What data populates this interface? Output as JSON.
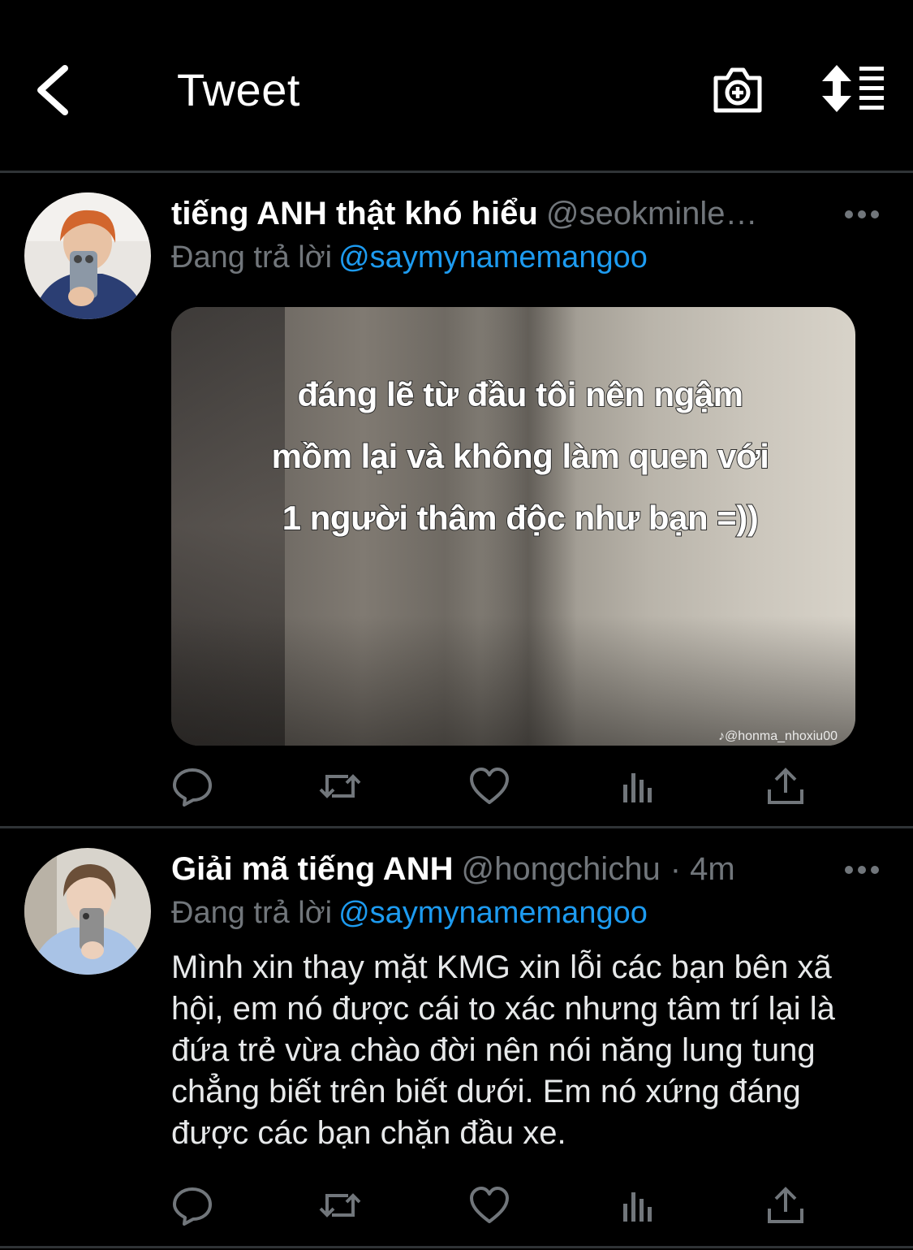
{
  "header": {
    "title": "Tweet",
    "back_icon": "back-arrow-icon",
    "camera_icon": "camera-plus-icon",
    "sort_icon": "sort-replies-icon"
  },
  "tweets": [
    {
      "display_name": "tiếng ANH thật khó hiểu",
      "handle": "@seokminle…",
      "timestamp": "",
      "reply_prefix": "Đang trả lời",
      "reply_to": "@saymynamemangoo",
      "media_caption": "đáng lẽ từ đầu tôi nên ngậm mồm lại và không làm quen với 1 người thâm độc như bạn =))",
      "media_watermark": "♪@honma_nhoxiu00"
    },
    {
      "display_name": "Giải mã tiếng ANH",
      "handle": "@hongchichu",
      "timestamp": "· 4m",
      "reply_prefix": "Đang trả lời",
      "reply_to": "@saymynamemangoo",
      "text": "Mình xin thay mặt KMG xin lỗi các bạn bên xã hội, em nó được cái to xác nhưng tâm trí lại là đứa trẻ vừa chào đời nên nói năng lung tung chẳng biết trên biết dưới. Em nó xứng đáng được các bạn chặn đầu xe."
    }
  ],
  "action_icons": [
    "reply-icon",
    "retweet-icon",
    "like-icon",
    "analytics-icon",
    "share-icon"
  ],
  "colors": {
    "background": "#000000",
    "link": "#1d9bf0",
    "muted": "#71767b",
    "divider": "#2f3336"
  }
}
